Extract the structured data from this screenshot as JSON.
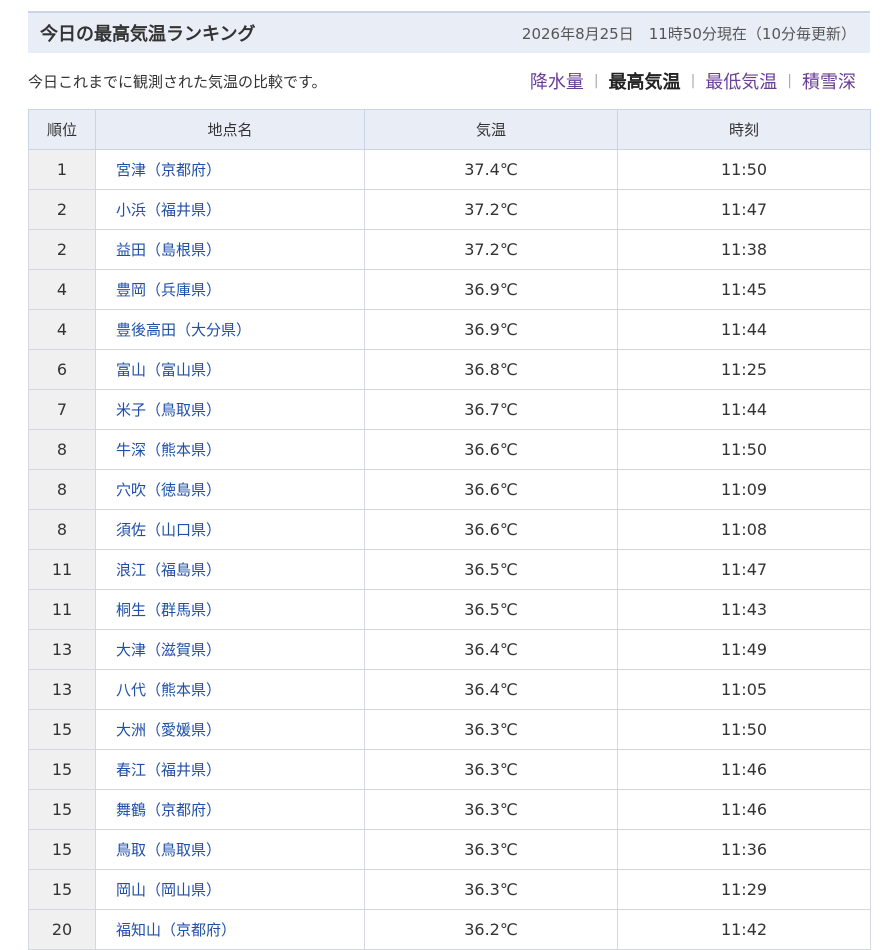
{
  "header": {
    "title": "今日の最高気温ランキング",
    "time": "2026年8月25日　11時50分現在（10分毎更新）"
  },
  "description": "今日これまでに観測された気温の比較です。",
  "nav": {
    "items": [
      {
        "label": "降水量",
        "current": false
      },
      {
        "label": "最高気温",
        "current": true
      },
      {
        "label": "最低気温",
        "current": false
      },
      {
        "label": "積雪深",
        "current": false
      }
    ],
    "separator": "|"
  },
  "table": {
    "columns": [
      "順位",
      "地点名",
      "気温",
      "時刻"
    ],
    "rows": [
      {
        "rank": "1",
        "place": "宮津（京都府）",
        "temp": "37.4℃",
        "time": "11:50"
      },
      {
        "rank": "2",
        "place": "小浜（福井県）",
        "temp": "37.2℃",
        "time": "11:47"
      },
      {
        "rank": "2",
        "place": "益田（島根県）",
        "temp": "37.2℃",
        "time": "11:38"
      },
      {
        "rank": "4",
        "place": "豊岡（兵庫県）",
        "temp": "36.9℃",
        "time": "11:45"
      },
      {
        "rank": "4",
        "place": "豊後高田（大分県）",
        "temp": "36.9℃",
        "time": "11:44"
      },
      {
        "rank": "6",
        "place": "富山（富山県）",
        "temp": "36.8℃",
        "time": "11:25"
      },
      {
        "rank": "7",
        "place": "米子（鳥取県）",
        "temp": "36.7℃",
        "time": "11:44"
      },
      {
        "rank": "8",
        "place": "牛深（熊本県）",
        "temp": "36.6℃",
        "time": "11:50"
      },
      {
        "rank": "8",
        "place": "穴吹（徳島県）",
        "temp": "36.6℃",
        "time": "11:09"
      },
      {
        "rank": "8",
        "place": "須佐（山口県）",
        "temp": "36.6℃",
        "time": "11:08"
      },
      {
        "rank": "11",
        "place": "浪江（福島県）",
        "temp": "36.5℃",
        "time": "11:47"
      },
      {
        "rank": "11",
        "place": "桐生（群馬県）",
        "temp": "36.5℃",
        "time": "11:43"
      },
      {
        "rank": "13",
        "place": "大津（滋賀県）",
        "temp": "36.4℃",
        "time": "11:49"
      },
      {
        "rank": "13",
        "place": "八代（熊本県）",
        "temp": "36.4℃",
        "time": "11:05"
      },
      {
        "rank": "15",
        "place": "大洲（愛媛県）",
        "temp": "36.3℃",
        "time": "11:50"
      },
      {
        "rank": "15",
        "place": "春江（福井県）",
        "temp": "36.3℃",
        "time": "11:46"
      },
      {
        "rank": "15",
        "place": "舞鶴（京都府）",
        "temp": "36.3℃",
        "time": "11:46"
      },
      {
        "rank": "15",
        "place": "鳥取（鳥取県）",
        "temp": "36.3℃",
        "time": "11:36"
      },
      {
        "rank": "15",
        "place": "岡山（岡山県）",
        "temp": "36.3℃",
        "time": "11:29"
      },
      {
        "rank": "20",
        "place": "福知山（京都府）",
        "temp": "36.2℃",
        "time": "11:42"
      }
    ]
  }
}
